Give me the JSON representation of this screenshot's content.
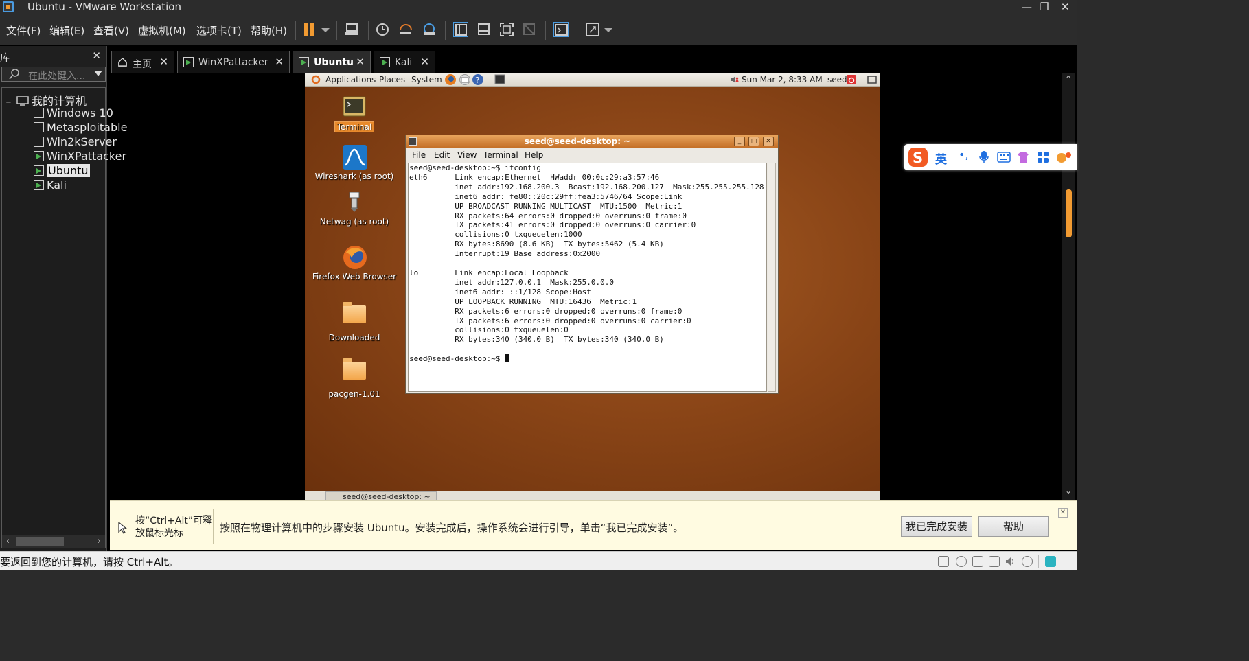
{
  "window": {
    "title": "Ubuntu - VMware Workstation",
    "min": "—",
    "restore": "❐",
    "close": "✕"
  },
  "menu": [
    "文件(F)",
    "编辑(E)",
    "查看(V)",
    "虚拟机(M)",
    "选项卡(T)",
    "帮助(H)"
  ],
  "toolbar": {
    "icons": [
      "pause-icon",
      "dropdown-arrow-icon",
      "send-ctrl-alt-del-icon",
      "snapshot-icon",
      "revert-snapshot-icon",
      "manage-snapshots-icon",
      "show-library-icon",
      "thumbnail-bar-icon",
      "full-screen-icon",
      "unity-icon",
      "console-view-icon",
      "stretch-guest-icon",
      "dropdown-arrow-icon"
    ]
  },
  "library": {
    "title": "库",
    "close": "✕",
    "search_placeholder": "在此处键入...",
    "root": "我的计算机",
    "items": [
      {
        "label": "Windows 10",
        "running": false,
        "selected": false
      },
      {
        "label": "Metasploitable",
        "running": false,
        "selected": false
      },
      {
        "label": "Win2kServer",
        "running": false,
        "selected": false
      },
      {
        "label": "WinXPattacker",
        "running": true,
        "selected": false
      },
      {
        "label": "Ubuntu",
        "running": true,
        "selected": true
      },
      {
        "label": "Kali",
        "running": true,
        "selected": false
      }
    ]
  },
  "tabs": [
    {
      "label": "主页",
      "close": "✕",
      "active": false
    },
    {
      "label": "WinXPattacker",
      "close": "✕",
      "active": false
    },
    {
      "label": "Ubuntu",
      "close": "✕",
      "active": true
    },
    {
      "label": "Kali",
      "close": "✕",
      "active": false
    }
  ],
  "guest": {
    "panel": {
      "applications": "Applications",
      "places": "Places",
      "system": "System",
      "clock": "Sun Mar  2,  8:33 AM",
      "user": "seed"
    },
    "desktop_icons": [
      {
        "label": "Terminal"
      },
      {
        "label": "Wireshark (as root)"
      },
      {
        "label": "Netwag (as root)"
      },
      {
        "label": "Firefox Web Browser"
      },
      {
        "label": "Downloaded"
      },
      {
        "label": "pacgen-1.01"
      }
    ],
    "terminal": {
      "title": "seed@seed-desktop: ~",
      "menu": [
        "File",
        "Edit",
        "View",
        "Terminal",
        "Help"
      ],
      "lines": [
        "seed@seed-desktop:~$ ifconfig",
        "eth6      Link encap:Ethernet  HWaddr 00:0c:29:a3:57:46",
        "          inet addr:192.168.200.3  Bcast:192.168.200.127  Mask:255.255.255.128",
        "          inet6 addr: fe80::20c:29ff:fea3:5746/64 Scope:Link",
        "          UP BROADCAST RUNNING MULTICAST  MTU:1500  Metric:1",
        "          RX packets:64 errors:0 dropped:0 overruns:0 frame:0",
        "          TX packets:41 errors:0 dropped:0 overruns:0 carrier:0",
        "          collisions:0 txqueuelen:1000",
        "          RX bytes:8690 (8.6 KB)  TX bytes:5462 (5.4 KB)",
        "          Interrupt:19 Base address:0x2000",
        "",
        "lo        Link encap:Local Loopback",
        "          inet addr:127.0.0.1  Mask:255.0.0.0",
        "          inet6 addr: ::1/128 Scope:Host",
        "          UP LOOPBACK RUNNING  MTU:16436  Metric:1",
        "          RX packets:6 errors:0 dropped:0 overruns:0 frame:0",
        "          TX packets:6 errors:0 dropped:0 overruns:0 carrier:0",
        "          collisions:0 txqueuelen:0",
        "          RX bytes:340 (340.0 B)  TX bytes:340 (340.0 B)",
        "",
        "seed@seed-desktop:~$ "
      ]
    },
    "taskbar_item": "seed@seed-desktop: ~"
  },
  "ime": {
    "mode": "英",
    "punct": "•,",
    "icons": [
      "sogou-logo-icon",
      "microphone-icon",
      "keyboard-icon",
      "skin-icon",
      "toolbox-icon",
      "more-icon"
    ]
  },
  "hint": {
    "release_line1": "按“Ctrl+Alt”可释",
    "release_line2": "放鼠标光标",
    "message": "按照在物理计算机中的步骤安装 Ubuntu。安装完成后，操作系统会进行引导，单击“我已完成安装”。",
    "done_button": "我已完成安装",
    "help_button": "帮助",
    "close": "✕"
  },
  "status": {
    "text": "要返回到您的计算机，请按 Ctrl+Alt。"
  },
  "colors": {
    "accent_orange": "#f29b32",
    "ubuntu_bg": "#8a4517",
    "hint_bg": "#fffbe1"
  }
}
